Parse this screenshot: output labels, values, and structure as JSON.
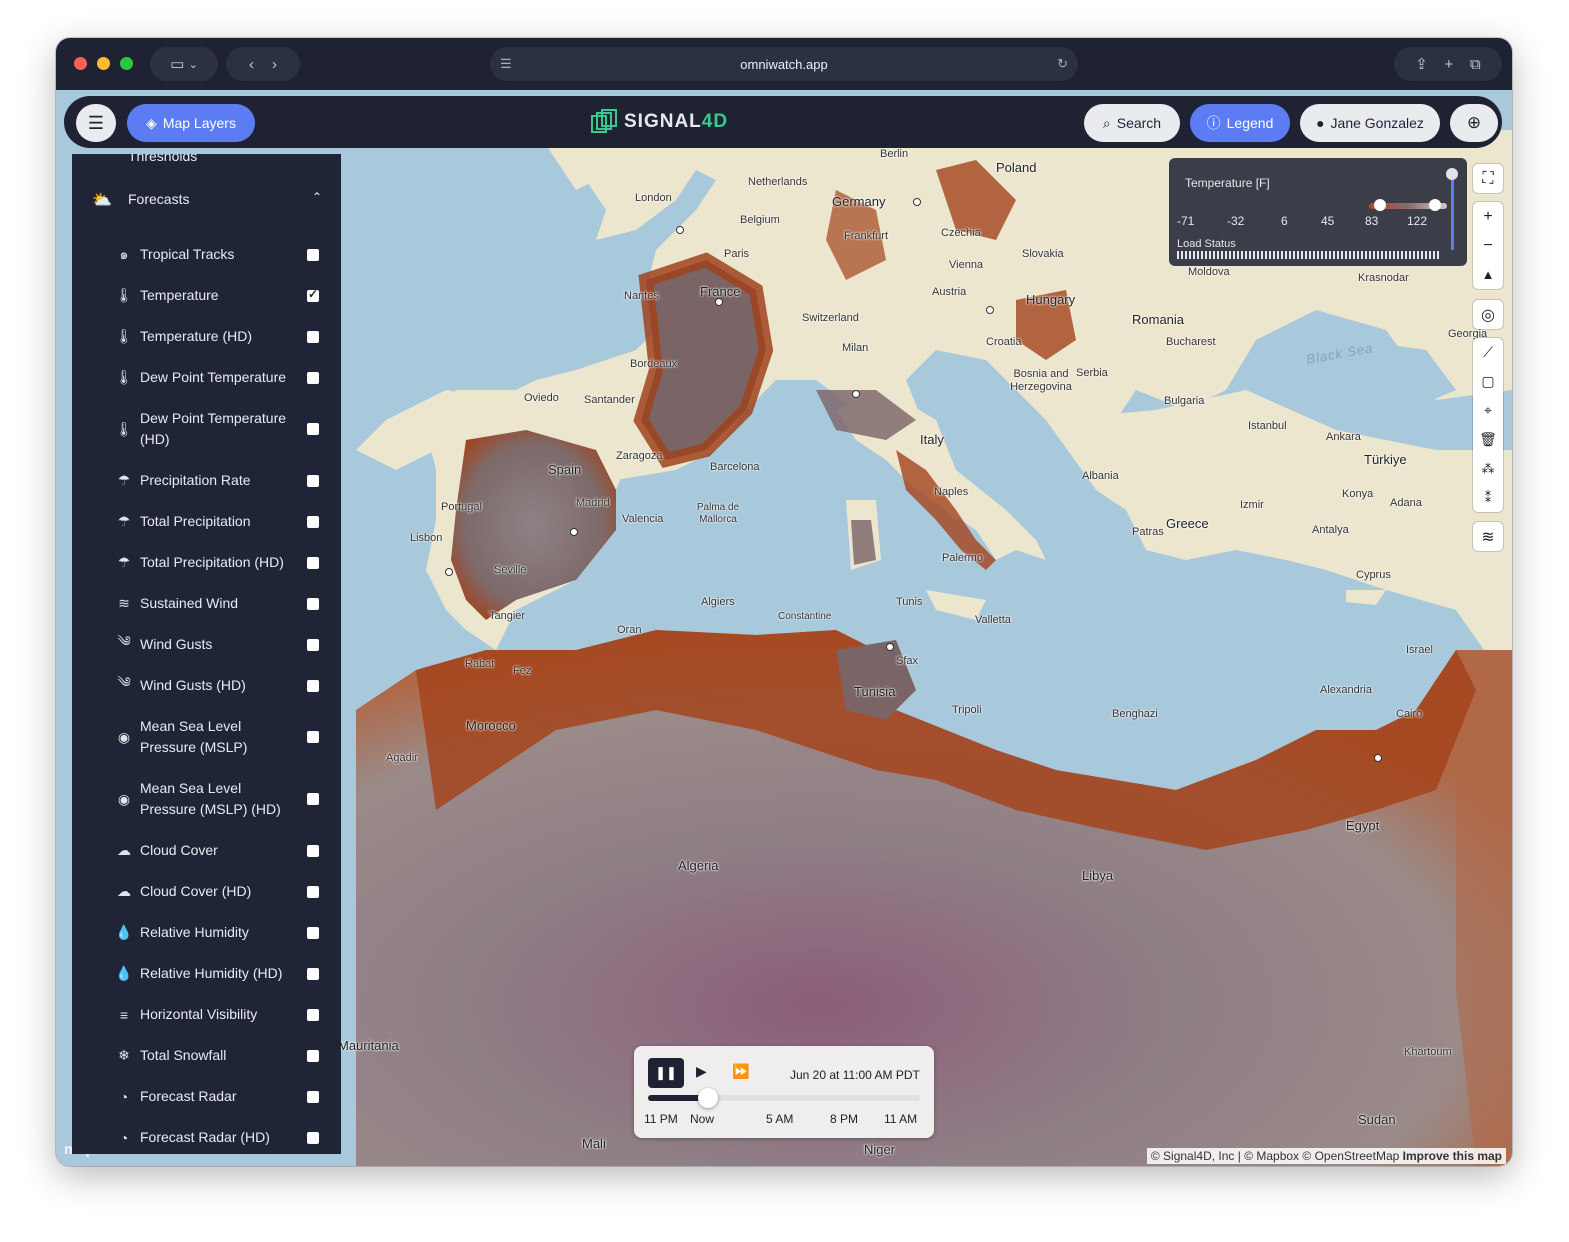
{
  "browser": {
    "url": "omniwatch.app"
  },
  "nav": {
    "map_layers": "Map Layers",
    "logo_part1": "SIGNAL",
    "logo_part2": "4D",
    "search": "Search",
    "legend": "Legend",
    "user": "Jane Gonzalez"
  },
  "panel": {
    "cut_item": "Thresholds",
    "section": "Forecasts",
    "items": [
      {
        "label": "Tropical Tracks",
        "icon": "hurricane-icon",
        "checked": false
      },
      {
        "label": "Temperature",
        "icon": "thermometer-icon",
        "checked": true
      },
      {
        "label": "Temperature (HD)",
        "icon": "thermometer-icon",
        "checked": false
      },
      {
        "label": "Dew Point Temperature",
        "icon": "thermometer-icon",
        "checked": false
      },
      {
        "label": "Dew Point Temperature (HD)",
        "icon": "thermometer-icon",
        "checked": false
      },
      {
        "label": "Precipitation Rate",
        "icon": "rain-cloud-icon",
        "checked": false
      },
      {
        "label": "Total Precipitation",
        "icon": "rain-cloud-icon",
        "checked": false
      },
      {
        "label": "Total Precipitation (HD)",
        "icon": "rain-cloud-icon",
        "checked": false
      },
      {
        "label": "Sustained Wind",
        "icon": "wind-icon",
        "checked": false
      },
      {
        "label": "Wind Gusts",
        "icon": "wind-gust-icon",
        "checked": false
      },
      {
        "label": "Wind Gusts (HD)",
        "icon": "wind-gust-icon",
        "checked": false
      },
      {
        "label": "Mean Sea Level Pressure (MSLP)",
        "icon": "gauge-icon",
        "checked": false
      },
      {
        "label": "Mean Sea Level Pressure (MSLP) (HD)",
        "icon": "gauge-icon",
        "checked": false
      },
      {
        "label": "Cloud Cover",
        "icon": "cloud-icon",
        "checked": false
      },
      {
        "label": "Cloud Cover (HD)",
        "icon": "cloud-icon",
        "checked": false
      },
      {
        "label": "Relative Humidity",
        "icon": "droplet-icon",
        "checked": false
      },
      {
        "label": "Relative Humidity (HD)",
        "icon": "droplet-icon",
        "checked": false
      },
      {
        "label": "Horizontal Visibility",
        "icon": "fog-icon",
        "checked": false
      },
      {
        "label": "Total Snowfall",
        "icon": "snow-cloud-icon",
        "checked": false
      },
      {
        "label": "Forecast Radar",
        "icon": "radar-icon",
        "checked": false
      },
      {
        "label": "Forecast Radar (HD)",
        "icon": "radar-icon",
        "checked": false
      }
    ]
  },
  "legend": {
    "title": "Temperature [F]",
    "ticks": [
      "-71",
      "-32",
      "6",
      "45",
      "83",
      "122"
    ],
    "load_status": "Load Status"
  },
  "player": {
    "datetime": "Jun 20 at 11:00 AM PDT",
    "ticks": [
      "11 PM",
      "Now",
      "5 AM",
      "8 PM",
      "11 AM"
    ],
    "progress": 0.22
  },
  "map": {
    "labels": [
      "Berlin",
      "Poland",
      "Netherlands",
      "Germany",
      "London",
      "Belgium",
      "Frankfurt",
      "Czechia",
      "Paris",
      "Vienna",
      "Slovakia",
      "Nantes",
      "France",
      "Austria",
      "Hungary",
      "Moldova",
      "Krasnodar",
      "Switzerland",
      "Romania",
      "Milan",
      "Croatia",
      "Bucharest",
      "Georgia",
      "Black Sea",
      "Bordeaux",
      "Bosnia and Herzegovina",
      "Serbia",
      "Oviedo",
      "Santander",
      "Bulgaria",
      "Zaragoza",
      "Italy",
      "Istanbul",
      "Ankara",
      "Türkiye",
      "Spain",
      "Barcelona",
      "Albania",
      "Portugal",
      "Madrid",
      "Naples",
      "Konya",
      "Adana",
      "Valencia",
      "Palma de Mallorca",
      "Izmir",
      "Greece",
      "Lisbon",
      "Patras",
      "Antalya",
      "Palermo",
      "Seville",
      "Cyprus",
      "Algiers",
      "Tunis",
      "Tangier",
      "Constantine",
      "Oran",
      "Valletta",
      "Israel",
      "Rabat",
      "Fez",
      "Sfax",
      "Tunisia",
      "Alexandria",
      "Tripoli",
      "Benghazi",
      "Cairo",
      "Morocco",
      "Agadir",
      "Egypt",
      "Algeria",
      "Libya",
      "Mauritania",
      "Khartoum",
      "Sudan",
      "Mali",
      "Niger"
    ],
    "attribution": "© Signal4D, Inc | © Mapbox © OpenStreetMap",
    "improve": "Improve this map",
    "mapbox": "mapbox"
  },
  "colors": {
    "accent": "#5b7cf2",
    "nav_bg": "#1e2233",
    "panel_bg": "#1f2537",
    "brand_green": "#39c98e"
  }
}
